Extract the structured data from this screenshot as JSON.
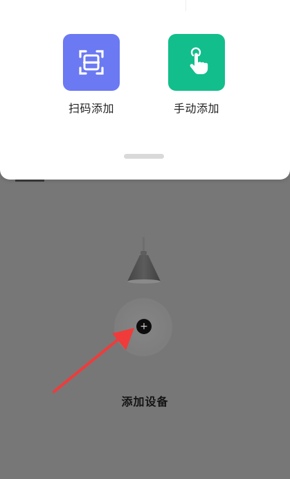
{
  "sheet": {
    "options": [
      {
        "label": "扫码添加",
        "icon": "scan-qr-icon",
        "color": "#6B79F2"
      },
      {
        "label": "手动添加",
        "icon": "hand-tap-icon",
        "color": "#12BE8C"
      }
    ]
  },
  "main": {
    "add_device_label": "添加设备",
    "add_button_symbol": "+"
  },
  "colors": {
    "overlay": "#777777",
    "arrow": "#F03B3B"
  }
}
